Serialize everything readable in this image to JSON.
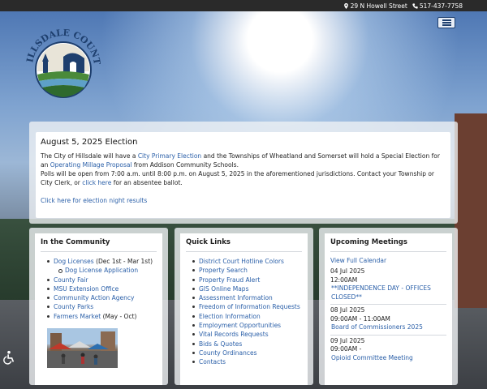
{
  "topbar": {
    "address": "29 N Howell Street",
    "phone": "517-437-7758",
    "address_icon": "map-marker-icon",
    "phone_icon": "phone-icon"
  },
  "logo": {
    "text": "HILLSDALE COUNTY"
  },
  "menu": {
    "icon": "hamburger-menu-icon"
  },
  "alert": {
    "title": "August 5, 2025 Election",
    "line1_pre": "The City of Hillsdale will have a ",
    "line1_link1": "City Primary Election",
    "line1_mid": " and the Townships of Wheatland and Somerset will hold a Special Election for an ",
    "line1_link2": "Operating Millage Proposal",
    "line1_post": " from Addison Community Schools.",
    "line2": "Polls will be open from 7:00 a.m. until 8:00 p.m. on August 5, 2025 in the aforementioned jurisdictions. Contact your Township or City Clerk, or ",
    "line2_link": "click here",
    "line2_post": " for an absentee ballot.",
    "results_link": "Click here for election night results"
  },
  "community": {
    "title": "In the Community",
    "items": [
      {
        "link": "Dog Licenses",
        "text": " (Dec 1st - Mar 1st)"
      },
      {
        "link": "Dog License Application",
        "text": "",
        "sub": true
      },
      {
        "link": "County Fair",
        "text": ""
      },
      {
        "link": "MSU Extension Office",
        "text": ""
      },
      {
        "link": "Community Action Agency",
        "text": ""
      },
      {
        "link": "County Parks",
        "text": ""
      },
      {
        "link": "Farmers Market",
        "text": " (May - Oct)"
      }
    ]
  },
  "quicklinks": {
    "title": "Quick Links",
    "items": [
      "District Court Hotline Colors",
      "Property Search",
      "Property Fraud Alert",
      "GIS Online Maps",
      "Assessment Information",
      "Freedom of Information Requests",
      "Election Information",
      "Employment Opportunities",
      "Vital Records Requests",
      "Bids & Quotes",
      "County Ordinances",
      "Contacts"
    ]
  },
  "meetings": {
    "title": "Upcoming Meetings",
    "calendar_link": "View Full Calendar",
    "items": [
      {
        "date": "04 Jul 2025",
        "time": "12:00AM",
        "title": "**INDEPENDENCE DAY - OFFICES CLOSED**"
      },
      {
        "date": "08 Jul 2025",
        "time": "09:00AM - 11:00AM",
        "title": "Board of Commissioners 2025"
      },
      {
        "date": "09 Jul 2025",
        "time": "09:00AM -",
        "title": "Opioid Committee Meeting"
      }
    ]
  },
  "accessibility": {
    "icon": "wheelchair-accessibility-icon"
  },
  "colors": {
    "link": "#2a5fa8",
    "topbar": "#2a2a2a",
    "brand_navy": "#1e3f6e",
    "brand_green": "#3a7a3a"
  }
}
